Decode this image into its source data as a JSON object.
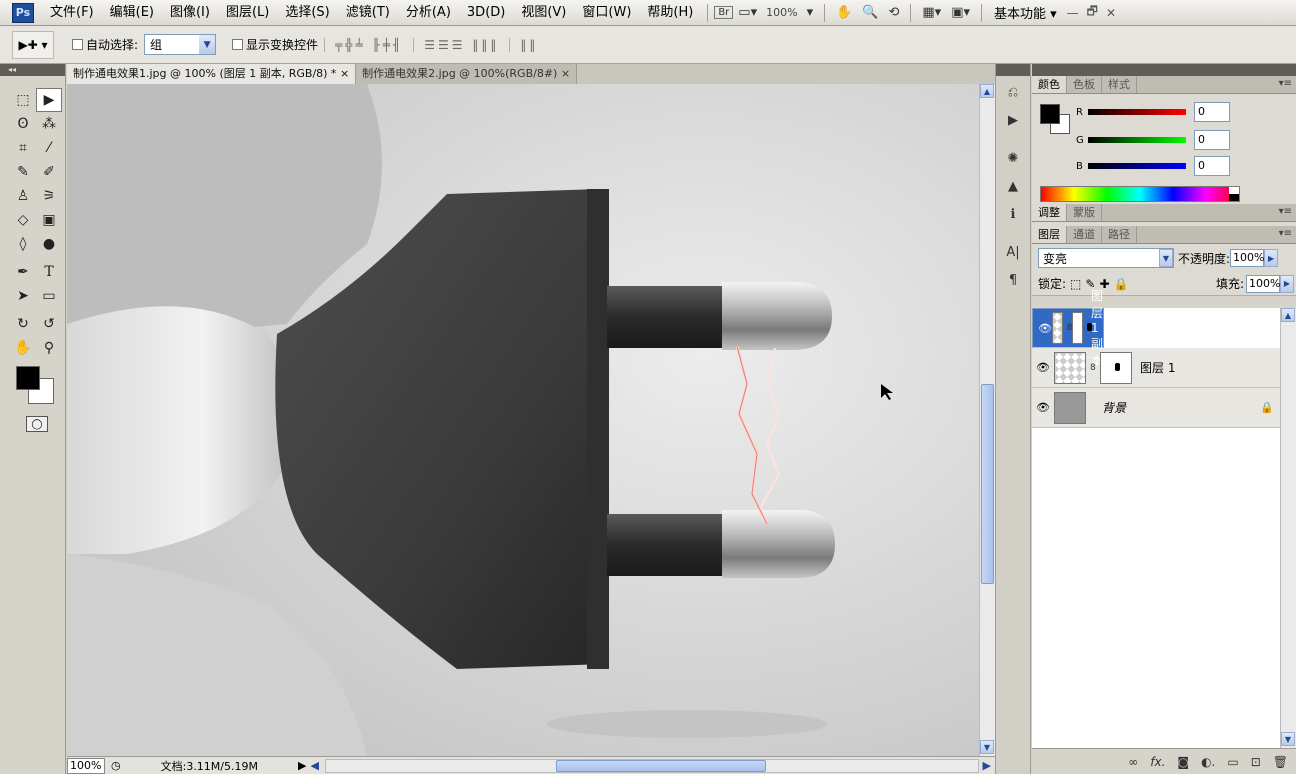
{
  "app": {
    "logo": "Ps"
  },
  "menu": [
    "文件(F)",
    "编辑(E)",
    "图像(I)",
    "图层(L)",
    "选择(S)",
    "滤镜(T)",
    "分析(A)",
    "3D(D)",
    "视图(V)",
    "窗口(W)",
    "帮助(H)"
  ],
  "menubar": {
    "bridge": "Br",
    "zoom": "100%",
    "workspace": "基本功能 ▾",
    "minimize": "—",
    "restore": "🗗",
    "close": "✕"
  },
  "options": {
    "auto_select_label": "自动选择:",
    "auto_select_value": "组",
    "show_transform_label": "显示变换控件"
  },
  "tabs": [
    {
      "label": "制作通电效果1.jpg @ 100% (图层 1 副本, RGB/8) *",
      "close": "×"
    },
    {
      "label": "制作通电效果2.jpg @ 100%(RGB/8#)",
      "close": "×"
    }
  ],
  "status": {
    "zoom": "100%",
    "doc_info": "文档:3.11M/5.19M"
  },
  "color_panel": {
    "tabs": [
      "颜色",
      "色板",
      "样式"
    ],
    "r_label": "R",
    "g_label": "G",
    "b_label": "B",
    "r": "0",
    "g": "0",
    "b": "0"
  },
  "adjust_panel": {
    "tabs": [
      "调整",
      "蒙版"
    ]
  },
  "layers_panel": {
    "tabs": [
      "图层",
      "通道",
      "路径"
    ],
    "blend_mode": "变亮",
    "opacity_label": "不透明度:",
    "opacity": "100%",
    "lock_label": "锁定:",
    "fill_label": "填充:",
    "fill": "100%",
    "layers": [
      {
        "name": "图层 1 副本",
        "selected": true,
        "has_mask": true
      },
      {
        "name": "图层 1",
        "selected": false,
        "has_mask": true
      },
      {
        "name": "背景",
        "selected": false,
        "locked": true
      }
    ],
    "bottom_icons": [
      "link-icon",
      "fx-icon",
      "mask-icon",
      "adjustment-icon",
      "group-icon",
      "new-layer-icon",
      "trash-icon"
    ]
  },
  "colors": {
    "accent_selection": "#3169c6",
    "fg_color": "#000000",
    "bg_color": "#ffffff"
  }
}
